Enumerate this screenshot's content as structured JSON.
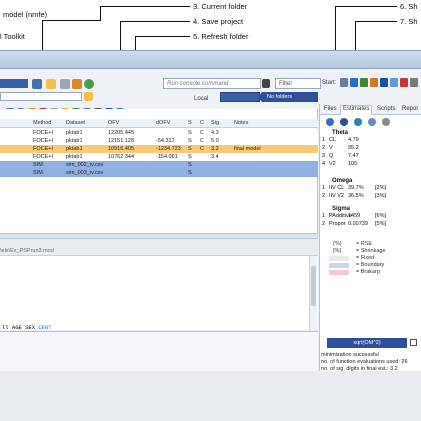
{
  "annotations": {
    "top_left": [
      "model (nmfe)",
      "l Toolkit"
    ],
    "center": [
      "3. Current folder",
      "4. Save project",
      "5. Refresh folder"
    ],
    "right": [
      "6. Sh",
      "7. Sh"
    ]
  },
  "toolbar": {
    "console_placeholder": "Run console command",
    "filter_label": "Filter",
    "start_label": "Start:",
    "local_label": "Local",
    "folders_button": "No folders"
  },
  "table": {
    "columns": [
      "Method",
      "Dataset",
      "OFV",
      "dOFV",
      "S",
      "C",
      "Sig",
      "Notes"
    ],
    "rows": [
      {
        "method": "FOCE+I",
        "dataset": "pktab1",
        "ofv": "12205.445",
        "dofv": "",
        "s": "S",
        "c": "C",
        "sig": "4.3",
        "notes": "",
        "style": "white"
      },
      {
        "method": "FOCE+I",
        "dataset": "pktab1",
        "ofv": "12151.128",
        "dofv": "-54.317",
        "s": "S",
        "c": "C",
        "sig": "5.0",
        "notes": "",
        "style": "white"
      },
      {
        "method": "FOCE+I",
        "dataset": "pktab1",
        "ofv": "10916.405",
        "dofv": "-1234.723",
        "s": "S",
        "c": "C",
        "sig": "3.2",
        "notes": "final model",
        "style": "orange"
      },
      {
        "method": "FOCE+I",
        "dataset": "pktab1",
        "ofv": "10762.344",
        "dofv": "-154.061",
        "s": "S",
        "c": "",
        "sig": "3.4",
        "notes": "",
        "style": "white"
      },
      {
        "method": "SIM",
        "dataset": "sim_002_iv.csv",
        "ofv": "",
        "dofv": "",
        "s": "S",
        "c": "",
        "sig": "",
        "notes": "",
        "style": "blue"
      },
      {
        "method": "SIM",
        "dataset": "sim_003_iv.csv",
        "ofv": "",
        "dofv": "",
        "s": "S",
        "c": "",
        "sig": "",
        "notes": "",
        "style": "blue"
      }
    ]
  },
  "editor": {
    "path": "\\els\\Ex_PSPrun3.mod",
    "code_prefix": "ll ",
    "code_vars": "AGE SEX ",
    "code_kw": "CENT"
  },
  "right_panel": {
    "tabs": [
      "Files",
      "Estimates",
      "Scripts",
      "Repor"
    ],
    "active_tab": "Estimates",
    "theta_label": "Theta",
    "theta": [
      {
        "idx": "1",
        "name": "CL",
        "value": "4.79"
      },
      {
        "idx": "2",
        "name": "V",
        "value": "95.2"
      },
      {
        "idx": "3",
        "name": "Q",
        "value": "7.47"
      },
      {
        "idx": "4",
        "name": "V2",
        "value": "105"
      }
    ],
    "omega_label": "Omega",
    "omega": [
      {
        "idx": "1",
        "name": "IIV CL",
        "value": "39.7%",
        "rse": "[2%]"
      },
      {
        "idx": "2",
        "name": "IIV V2",
        "value": "36.5%",
        "rse": "[3%]"
      }
    ],
    "sigma_label": "Sigma",
    "sigma": [
      {
        "idx": "1",
        "name": "PAdditive",
        "value": "1459",
        "rse": "[6%]"
      },
      {
        "idx": "2",
        "name": "Propor",
        "value": "0.00739",
        "rse": "[5%]"
      }
    ],
    "legend": [
      {
        "prefix": "(%)",
        "label": "= RSE"
      },
      {
        "prefix": "[%]",
        "label": "= Shrinkage"
      },
      {
        "prefix": "",
        "label": "= Fixed"
      },
      {
        "prefix": "",
        "label": "= Boundary"
      },
      {
        "prefix": "",
        "label": "= Brakarp"
      }
    ],
    "sqrt_button": "sqrt(OM^2)",
    "output": [
      "minimization successful",
      "no. of function evaluations used:  26",
      "no. of sig. digits in final est.:  3.2"
    ]
  },
  "colors": {
    "accent": "#2f4f9a",
    "orange_row": "#f9c97a",
    "blue_row": "#8fb0e0"
  }
}
